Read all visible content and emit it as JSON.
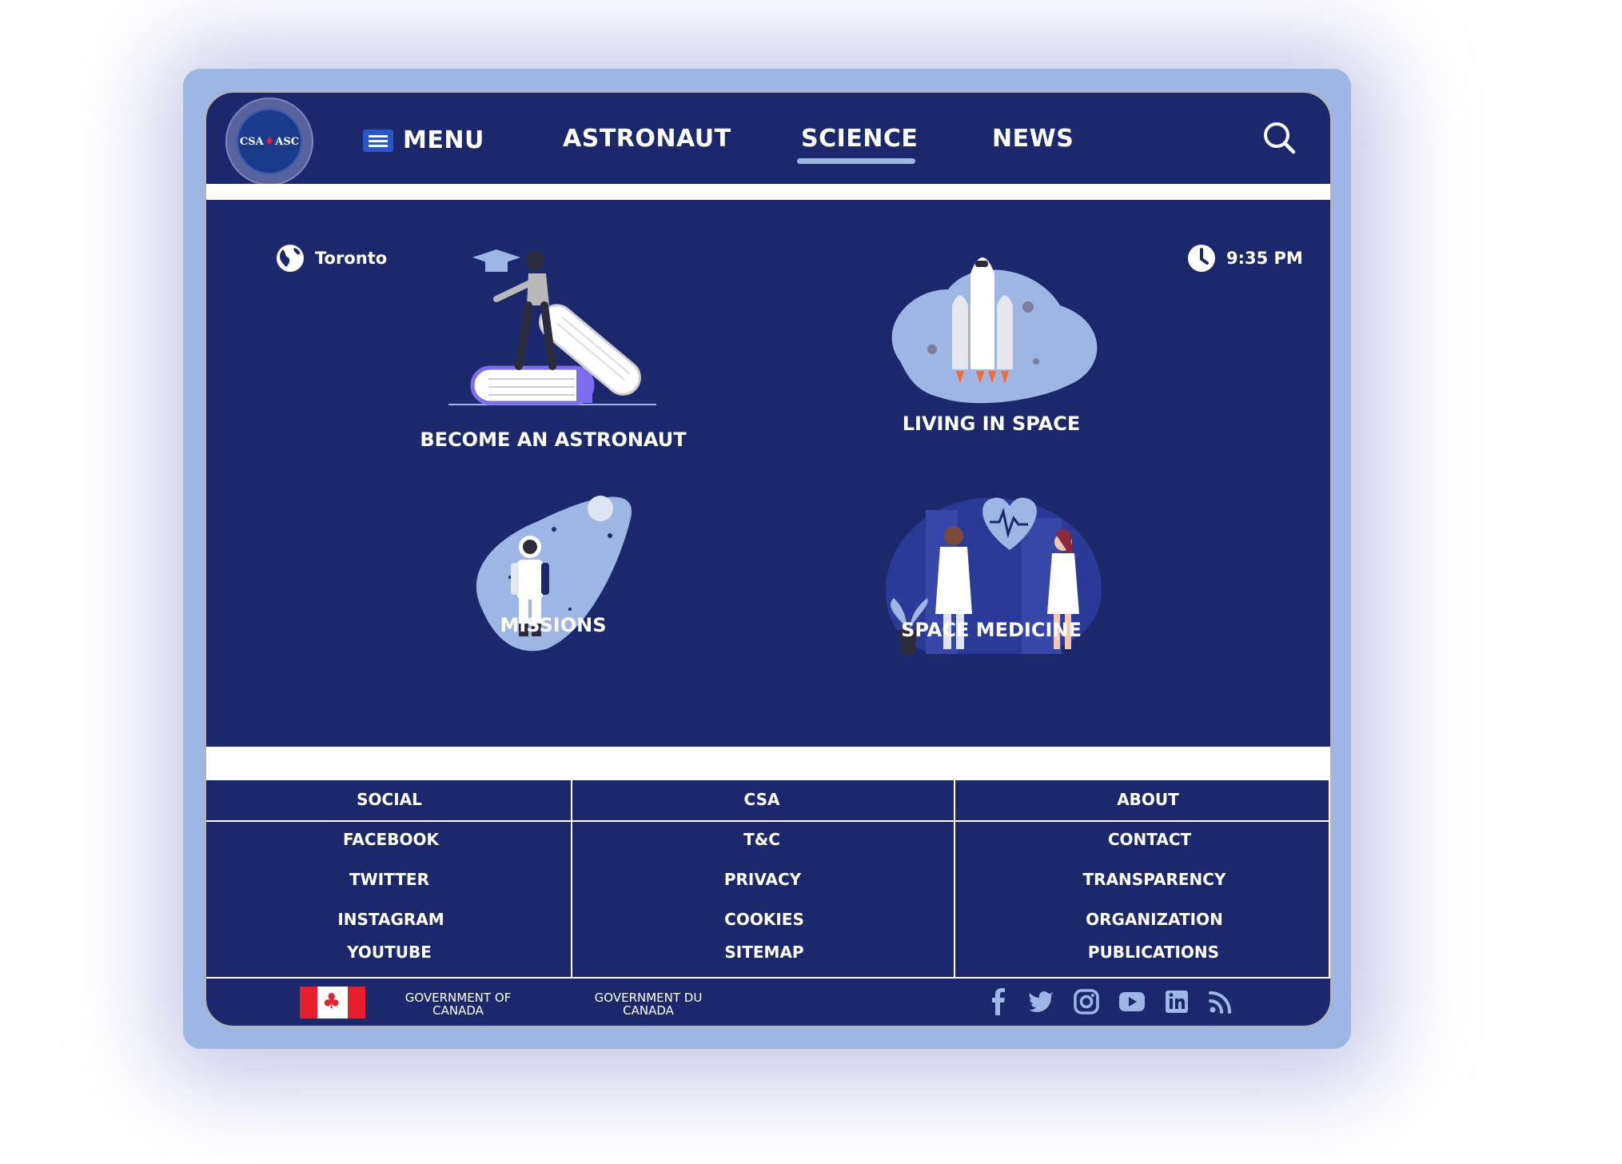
{
  "logo": {
    "left": "CSA",
    "right": "ASC"
  },
  "nav": {
    "menu_label": "MENU",
    "items": [
      {
        "label": "ASTRONAUT",
        "active": false
      },
      {
        "label": "SCIENCE",
        "active": true
      },
      {
        "label": "NEWS",
        "active": false
      }
    ],
    "search_icon": "search-icon"
  },
  "info": {
    "location": "Toronto",
    "time": "9:35 PM"
  },
  "cards": [
    {
      "label": "BECOME AN ASTRONAUT",
      "icon": "graduate-books-illustration"
    },
    {
      "label": "LIVING IN SPACE",
      "icon": "rocket-illustration"
    },
    {
      "label": "MISSIONS",
      "icon": "astronaut-illustration"
    },
    {
      "label": "SPACE MEDICINE",
      "icon": "doctors-heart-illustration"
    }
  ],
  "footer": {
    "columns": [
      {
        "heading": "SOCIAL",
        "items": [
          "FACEBOOK",
          "TWITTER",
          "INSTAGRAM",
          "YOUTUBE"
        ]
      },
      {
        "heading": "CSA",
        "items": [
          "T&C",
          "PRIVACY",
          "COOKIES",
          "SITEMAP"
        ]
      },
      {
        "heading": "ABOUT",
        "items": [
          "CONTACT",
          "TRANSPARENCY",
          "ORGANIZATION",
          "PUBLICATIONS"
        ]
      }
    ],
    "gov_en": [
      "GOVERNMENT OF",
      "CANADA"
    ],
    "gov_fr": [
      "GOVERNMENT DU",
      "CANADA"
    ],
    "social_icons": [
      "facebook-icon",
      "twitter-icon",
      "instagram-icon",
      "youtube-icon",
      "linkedin-icon",
      "rss-icon"
    ]
  },
  "colors": {
    "navy": "#1b296c",
    "frame": "#9eb6e3",
    "accent_light": "#9eb6e3",
    "white": "#ffffff"
  }
}
